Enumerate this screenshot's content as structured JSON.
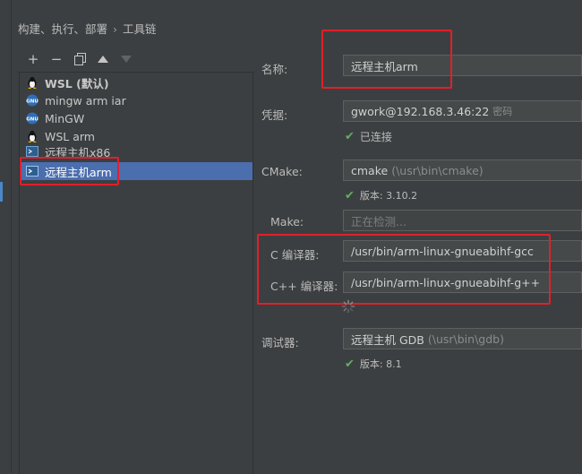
{
  "breadcrumb": {
    "parent": "构建、执行、部署",
    "separator": "›",
    "current": "工具链"
  },
  "toolbar": {
    "add_icon": "+",
    "remove_icon": "−",
    "copy_icon": "⧉",
    "up_icon": "▲",
    "down_icon": "▼"
  },
  "toolchains": [
    {
      "label": "WSL (默认)",
      "icon": "linux-icon"
    },
    {
      "label": "mingw arm iar",
      "icon": "gnu-icon"
    },
    {
      "label": "MinGW",
      "icon": "gnu-icon"
    },
    {
      "label": "WSL arm",
      "icon": "linux-icon"
    },
    {
      "label": "远程主机x86",
      "icon": "remote-host-icon"
    },
    {
      "label": "远程主机arm",
      "icon": "remote-host-icon",
      "selected": true
    }
  ],
  "form": {
    "name_label": "名称:",
    "name_value": "远程主机arm",
    "credentials_label": "凭据:",
    "credentials_value": "gwork@192.168.3.46:22",
    "credentials_suffix": "密码",
    "connected_status": "已连接",
    "cmake_label": "CMake:",
    "cmake_value": "cmake",
    "cmake_path": "(\\usr\\bin\\cmake)",
    "cmake_version": "版本: 3.10.2",
    "make_label": "Make:",
    "make_placeholder": "正在检测...",
    "c_compiler_label": "C 编译器:",
    "c_compiler_value": "/usr/bin/arm-linux-gnueabihf-gcc",
    "cpp_compiler_label": "C++ 编译器:",
    "cpp_compiler_value": "/usr/bin/arm-linux-gnueabihf-g++",
    "debugger_label": "调试器:",
    "debugger_value": "远程主机 GDB",
    "debugger_path": "(\\usr\\bin\\gdb)",
    "debugger_version": "版本: 8.1"
  },
  "colors": {
    "background": "#3c3f41",
    "selection": "#4b6eaf",
    "highlight_box": "#e0202a",
    "success": "#5fb05f"
  }
}
